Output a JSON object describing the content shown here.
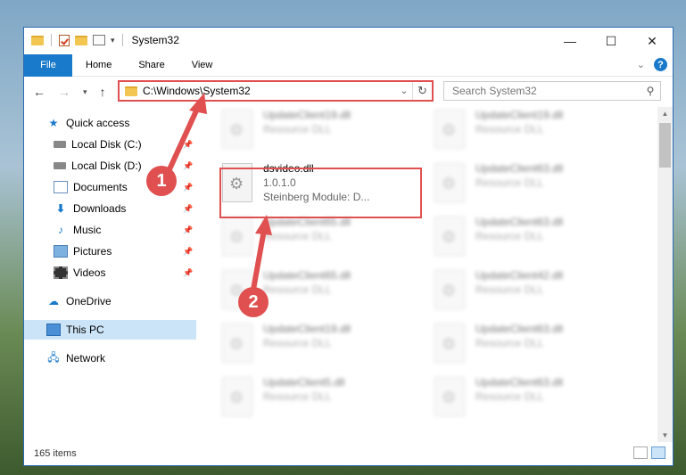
{
  "window": {
    "title": "System32"
  },
  "ribbon": {
    "tabs": [
      "File",
      "Home",
      "Share",
      "View"
    ],
    "help": "?"
  },
  "nav": {
    "address": "C:\\Windows\\System32",
    "search_placeholder": "Search System32"
  },
  "sidebar": {
    "items": [
      {
        "label": "Quick access",
        "icon": "star-icon"
      },
      {
        "label": "Local Disk (C:)",
        "icon": "drive-icon"
      },
      {
        "label": "Local Disk (D:)",
        "icon": "drive-icon"
      },
      {
        "label": "Documents",
        "icon": "documents-icon"
      },
      {
        "label": "Downloads",
        "icon": "downloads-icon"
      },
      {
        "label": "Music",
        "icon": "music-icon"
      },
      {
        "label": "Pictures",
        "icon": "pictures-icon"
      },
      {
        "label": "Videos",
        "icon": "videos-icon"
      },
      {
        "label": "OneDrive",
        "icon": "onedrive-icon"
      },
      {
        "label": "This PC",
        "icon": "this-pc-icon"
      },
      {
        "label": "Network",
        "icon": "network-icon"
      }
    ]
  },
  "files": [
    {
      "name": "UpdateClient19.dll",
      "type": "Resource DLL"
    },
    {
      "name": "UpdateClient19.dll",
      "type": "Resource DLL"
    },
    {
      "name": "dsvideo.dll",
      "version": "1.0.1.0",
      "desc": "Steinberg Module: D..."
    },
    {
      "name": "UpdateClient63.dll",
      "type": "Resource DLL"
    },
    {
      "name": "UpdateClient65.dll",
      "type": "Resource DLL"
    },
    {
      "name": "UpdateClient63.dll",
      "type": "Resource DLL"
    },
    {
      "name": "UpdateClient65.dll",
      "type": "Resource DLL"
    },
    {
      "name": "UpdateClient42.dll",
      "type": "Resource DLL"
    },
    {
      "name": "UpdateClient19.dll",
      "type": "Resource DLL"
    },
    {
      "name": "UpdateClient63.dll",
      "type": "Resource DLL"
    },
    {
      "name": "UpdateClient5.dll",
      "type": "Resource DLL"
    },
    {
      "name": "UpdateClient63.dll",
      "type": "Resource DLL"
    }
  ],
  "status": {
    "count": "165 items"
  },
  "callouts": [
    "1",
    "2"
  ],
  "colors": {
    "highlight": "#e05050",
    "accent": "#1979ca"
  }
}
